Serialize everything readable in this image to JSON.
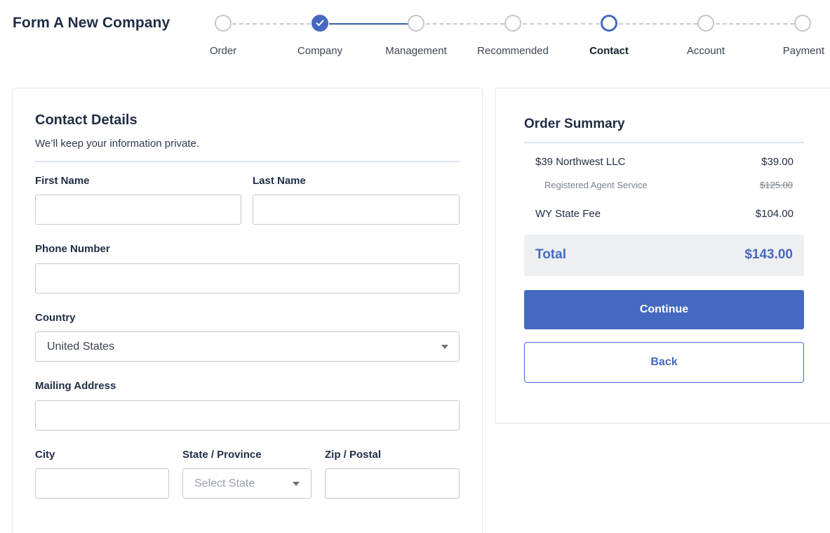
{
  "page_title": "Form A New Company",
  "stepper": {
    "steps": [
      {
        "label": "Order",
        "state": "upcoming"
      },
      {
        "label": "Company",
        "state": "done"
      },
      {
        "label": "Management",
        "state": "upcoming"
      },
      {
        "label": "Recommended",
        "state": "upcoming"
      },
      {
        "label": "Contact",
        "state": "current"
      },
      {
        "label": "Account",
        "state": "upcoming"
      },
      {
        "label": "Payment",
        "state": "upcoming"
      }
    ]
  },
  "contact": {
    "title": "Contact Details",
    "subtitle": "We’ll keep your information private.",
    "first_name_label": "First Name",
    "first_name_value": "",
    "last_name_label": "Last Name",
    "last_name_value": "",
    "phone_label": "Phone Number",
    "phone_value": "",
    "country_label": "Country",
    "country_value": "United States",
    "address_label": "Mailing Address",
    "address_value": "",
    "city_label": "City",
    "city_value": "",
    "state_label": "State / Province",
    "state_placeholder": "Select State",
    "zip_label": "Zip / Postal",
    "zip_value": ""
  },
  "summary": {
    "title": "Order Summary",
    "items": [
      {
        "label": "$39 Northwest LLC",
        "value": "$39.00"
      },
      {
        "label": "Registered Agent Service",
        "value": "$125.00",
        "struck": true
      },
      {
        "label": "WY State Fee",
        "value": "$104.00"
      }
    ],
    "total_label": "Total",
    "total_value": "$143.00",
    "continue_label": "Continue",
    "back_label": "Back"
  },
  "colors": {
    "accent": "#4569c0",
    "title": "#1f2d45",
    "total_bg": "#eeeff1"
  }
}
